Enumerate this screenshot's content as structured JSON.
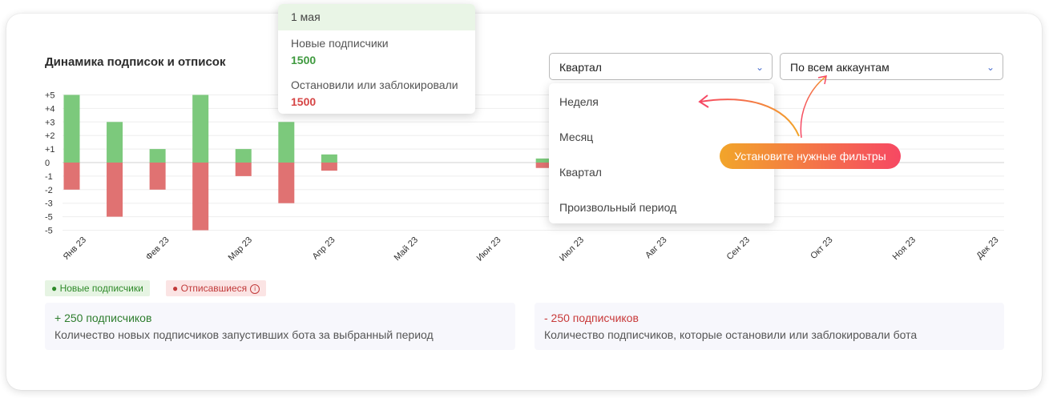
{
  "title": "Динамика подписок и отписок",
  "filters": {
    "period_selected": "Квартал",
    "account_selected": "По всем аккаунтам",
    "period_options": [
      "Неделя",
      "Месяц",
      "Квартал",
      "Произвольный период"
    ]
  },
  "tooltip": {
    "date": "1 мая",
    "new_label": "Новые подписчики",
    "new_value": "1500",
    "stopped_label": "Остановили или заблокировали",
    "stopped_value": "1500"
  },
  "hint": "Установите нужные фильтры",
  "legend": {
    "new": "● Новые подписчики",
    "unsub": "● Отписавшиеся"
  },
  "summary": {
    "new_title": "+ 250 подписчиков",
    "new_desc": "Количество новых подписчиков запустивших бота за выбранный период",
    "unsub_title": "- 250 подписчиков",
    "unsub_desc": "Количество подписчиков, которые остановили или заблокировали бота"
  },
  "colors": {
    "positive": "#7cc97c",
    "negative": "#e07272",
    "accent": "#4a6fd0"
  },
  "chart_data": {
    "type": "bar",
    "categories": [
      "Янв 23",
      "Фев 23",
      "Мар 23",
      "Апр 23",
      "Май 23",
      "Июн 23",
      "Июл 23",
      "Авг 23",
      "Сен 23",
      "Окт 23",
      "Ноя 23",
      "Дек 23"
    ],
    "y_ticks": [
      "+5",
      "+4",
      "+3",
      "+2",
      "+1",
      "0",
      "-1",
      "-2",
      "-3",
      "-5",
      "-5"
    ],
    "ylim": [
      -5,
      5
    ],
    "series": [
      {
        "name": "Новые подписчики",
        "values": [
          [
            1,
            5
          ],
          [
            1.5,
            3
          ],
          [
            2,
            1
          ],
          [
            2.5,
            5
          ],
          [
            3,
            1
          ],
          [
            3.5,
            3
          ],
          [
            4,
            0.6
          ],
          [
            6.5,
            0.3
          ]
        ]
      },
      {
        "name": "Отписавшиеся",
        "values": [
          [
            1,
            -2
          ],
          [
            1.5,
            -4
          ],
          [
            2,
            -2
          ],
          [
            2.5,
            -5
          ],
          [
            3,
            -1
          ],
          [
            3.5,
            -3
          ],
          [
            4,
            -0.6
          ],
          [
            6.5,
            -0.4
          ]
        ]
      }
    ]
  }
}
